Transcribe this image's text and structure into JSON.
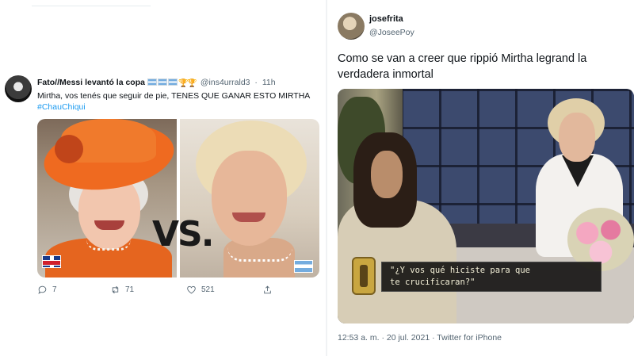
{
  "left_tweet": {
    "display_name": "Fato//Messi levantó la copa",
    "handle": "@ins4urrald3",
    "time": "11h",
    "text": "Mirtha, vos tenés que seguir de pie, TENES QUE GANAR ESTO MIRTHA",
    "hashtag": "#ChauChiqui",
    "image_overlay_text": "VS.",
    "actions": {
      "replies": "7",
      "retweets": "71",
      "likes": "521"
    }
  },
  "right_tweet": {
    "display_name": "josefrita",
    "handle": "@JoseePoy",
    "text": "Como se van a creer que rippió Mirtha legrand la verdadera inmortal",
    "subtitle_line1": "\"¿Y vos qué hiciste para que",
    "subtitle_line2": "te crucificaran?\"",
    "meta": "12:53 a. m. · 20 jul. 2021 · Twitter for iPhone"
  },
  "colors": {
    "link": "#1d9bf0",
    "muted": "#536471",
    "text": "#0f1419"
  }
}
